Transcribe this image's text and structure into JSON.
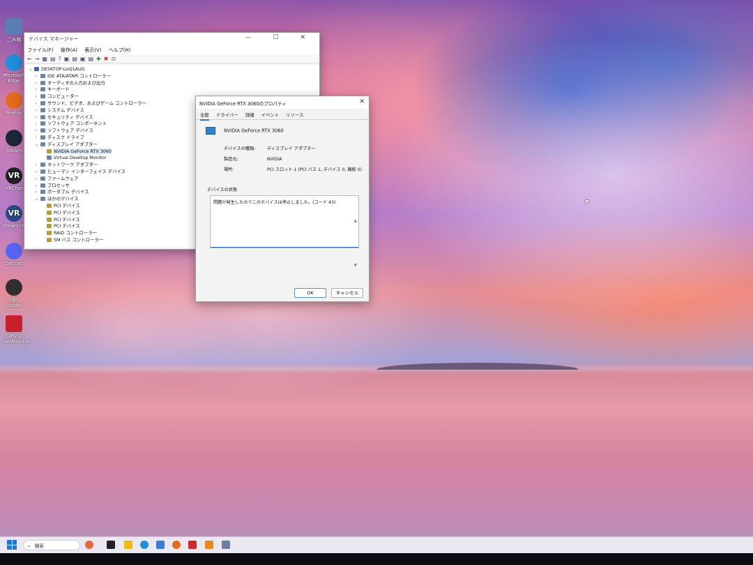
{
  "desktop_icons": [
    {
      "label": "ごみ箱",
      "icon": "recycle-bin-icon",
      "color": "#5a7fb5"
    },
    {
      "label": "Microsoft Edge",
      "icon": "edge-icon",
      "color": "#1e8fd8"
    },
    {
      "label": "Firefox",
      "icon": "firefox-icon",
      "color": "#e56a1c"
    },
    {
      "label": "Steam",
      "icon": "steam-icon",
      "color": "#1b2838"
    },
    {
      "label": "VRChat",
      "icon": "vrchat-icon",
      "color": "#222",
      "glyph": "VR"
    },
    {
      "label": "SteamVR",
      "icon": "steamvr-icon",
      "color": "#2b4b86",
      "glyph": "VR"
    },
    {
      "label": "Discord",
      "icon": "discord-icon",
      "color": "#5865f2"
    },
    {
      "label": "OBS Studio",
      "icon": "obs-icon",
      "color": "#302e31"
    },
    {
      "label": "GPU-Z HWMonitor",
      "icon": "hwmonitor-icon",
      "color": "#c8202a"
    }
  ],
  "device_manager": {
    "title": "デバイス マネージャー",
    "window_controls": "—  ☐  ✕",
    "menu": [
      "ファイル(F)",
      "操作(A)",
      "表示(V)",
      "ヘルプ(H)"
    ],
    "toolbar_glyphs": [
      "←",
      "→",
      "▦",
      "▤",
      "?",
      "▣",
      "▤",
      "▣",
      "▤",
      "✚",
      "✖",
      "⊙"
    ],
    "tree": [
      {
        "label": "DESKTOP-LUQ1AUG",
        "level": 0,
        "chev": "⌄",
        "kind": "root"
      },
      {
        "label": "IDE ATA/ATAPI コントローラー",
        "level": 1,
        "chev": "›"
      },
      {
        "label": "オーディオの入力および出力",
        "level": 1,
        "chev": "›"
      },
      {
        "label": "キーボード",
        "level": 1,
        "chev": "›"
      },
      {
        "label": "コンピューター",
        "level": 1,
        "chev": "›"
      },
      {
        "label": "サウンド、ビデオ、およびゲーム コントローラー",
        "level": 1,
        "chev": "›"
      },
      {
        "label": "システム デバイス",
        "level": 1,
        "chev": "›"
      },
      {
        "label": "セキュリティ デバイス",
        "level": 1,
        "chev": "›"
      },
      {
        "label": "ソフトウェア コンポーネント",
        "level": 1,
        "chev": "›"
      },
      {
        "label": "ソフトウェア デバイス",
        "level": 1,
        "chev": "›"
      },
      {
        "label": "ディスク ドライブ",
        "level": 1,
        "chev": "›"
      },
      {
        "label": "ディスプレイ アダプター",
        "level": 1,
        "chev": "⌄"
      },
      {
        "label": "NVIDIA GeForce RTX 3060",
        "level": 2,
        "chev": "",
        "kind": "warn",
        "selected": true
      },
      {
        "label": "Virtual Desktop Monitor",
        "level": 2,
        "chev": ""
      },
      {
        "label": "ネットワーク アダプター",
        "level": 1,
        "chev": "›"
      },
      {
        "label": "ヒューマン インターフェイス デバイス",
        "level": 1,
        "chev": "›"
      },
      {
        "label": "ファームウェア",
        "level": 1,
        "chev": "›"
      },
      {
        "label": "プロセッサ",
        "level": 1,
        "chev": "›"
      },
      {
        "label": "ポータブル デバイス",
        "level": 1,
        "chev": "›"
      },
      {
        "label": "ほかのデバイス",
        "level": 1,
        "chev": "⌄"
      },
      {
        "label": "PCI デバイス",
        "level": 2,
        "chev": "",
        "kind": "warn"
      },
      {
        "label": "PCI デバイス",
        "level": 2,
        "chev": "",
        "kind": "warn"
      },
      {
        "label": "PCI デバイス",
        "level": 2,
        "chev": "",
        "kind": "warn"
      },
      {
        "label": "PCI デバイス",
        "level": 2,
        "chev": "",
        "kind": "warn"
      },
      {
        "label": "RAID コントローラー",
        "level": 2,
        "chev": "",
        "kind": "warn"
      },
      {
        "label": "SM バス コントローラー",
        "level": 2,
        "chev": "",
        "kind": "warn"
      }
    ]
  },
  "properties": {
    "title": "NVIDIA GeForce RTX 3060のプロパティ",
    "close": "✕",
    "tabs": [
      "全般",
      "ドライバー",
      "詳細",
      "イベント",
      "リソース"
    ],
    "device_name": "NVIDIA GeForce RTX 3060",
    "fields": [
      {
        "k": "デバイスの種類:",
        "v": "ディスプレイ アダプター"
      },
      {
        "k": "製造元:",
        "v": "NVIDIA"
      },
      {
        "k": "場所:",
        "v": "PCI スロット 1 (PCI バス 1, デバイス 0, 機能 0)"
      }
    ],
    "status_legend": "デバイスの状態",
    "status_text": "問題が発生したのでこのデバイスは停止しました。(コード 43)",
    "ok": "OK",
    "cancel": "キャンセル"
  },
  "taskbar": {
    "search_placeholder": "検索",
    "icons": [
      {
        "icon": "widgets-icon",
        "color": "#e26a3b"
      },
      {
        "icon": "task-view-icon",
        "color": "#222"
      },
      {
        "icon": "file-explorer-icon",
        "color": "#f2b90f"
      },
      {
        "icon": "edge-icon",
        "color": "#1e8fd8"
      },
      {
        "icon": "photos-icon",
        "color": "#3a7bd5"
      },
      {
        "icon": "firefox-icon",
        "color": "#e56a1c"
      },
      {
        "icon": "app-red-icon",
        "color": "#d12a2a"
      },
      {
        "icon": "app-orange-icon",
        "color": "#e68a1a"
      },
      {
        "icon": "device-manager-icon",
        "color": "#6a7f9a"
      }
    ]
  }
}
